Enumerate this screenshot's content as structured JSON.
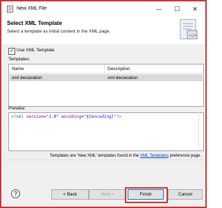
{
  "window": {
    "title": "New XML File",
    "minimize": "—",
    "maximize": "☐",
    "close": "✕"
  },
  "header": {
    "title": "Select XML Template",
    "subtitle": "Select a template as initial content in the XML page."
  },
  "options": {
    "use_template_label": "Use XML Template",
    "use_template_checked": true,
    "checkmark": "✓"
  },
  "templates": {
    "label": "Templates:",
    "columns": [
      "Name",
      "Description"
    ],
    "rows": [
      {
        "name": "xml declaration",
        "description": "xml declaration"
      }
    ]
  },
  "preview": {
    "label": "Preview:",
    "code": {
      "open": "<?xml",
      "attr1": "version",
      "eq1": "=",
      "val1": "\"1.0\"",
      "attr2": "encoding",
      "eq2": "=",
      "val2": "\"${encoding}\"",
      "close": "?>"
    }
  },
  "footer": {
    "prefix": "Templates are 'New XML' templates found in the ",
    "link": "XML Templates",
    "suffix": " preference page."
  },
  "buttons": {
    "help": "?",
    "back": "< Back",
    "next": "Next >",
    "finish": "Finish",
    "cancel": "Cancel"
  },
  "colors": {
    "highlight": "#d32f2f",
    "link": "#0645ad"
  }
}
